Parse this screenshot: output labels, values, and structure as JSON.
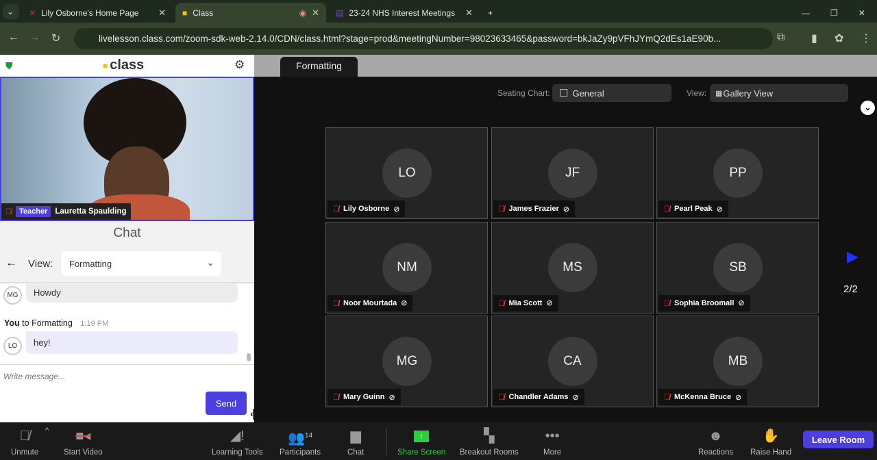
{
  "browser": {
    "tabs": [
      {
        "title": "Lily Osborne's Home Page"
      },
      {
        "title": "Class"
      },
      {
        "title": "23-24 NHS Interest Meetings"
      }
    ],
    "url": "livelesson.class.com/zoom-sdk-web-2.14.0/CDN/class.html?stage=prod&meetingNumber=98023633465&password=bkJaZy9pVFhJYmQ2dEs1aE90b..."
  },
  "app": {
    "logo": "class",
    "teacher_badge": "Teacher",
    "teacher_name": "Lauretta Spaulding"
  },
  "chat": {
    "title": "Chat",
    "view_label": "View:",
    "view_value": "Formatting",
    "messages": [
      {
        "initials": "MG",
        "text": "Howdy"
      },
      {
        "sender": "You",
        "to": "to Formatting",
        "time": "1:19 PM",
        "initials": "LO",
        "text": "hey!"
      }
    ],
    "placeholder": "Write message...",
    "send": "Send"
  },
  "room": {
    "tab": "Formatting",
    "seating_label": "Seating Chart:",
    "seating_value": "General",
    "view_label": "View:",
    "view_value": "Gallery View",
    "page": "2/2",
    "participants": [
      {
        "initials": "LO",
        "name": "Lily Osborne"
      },
      {
        "initials": "JF",
        "name": "James Frazier"
      },
      {
        "initials": "PP",
        "name": "Pearl Peak"
      },
      {
        "initials": "NM",
        "name": "Noor Mourtada"
      },
      {
        "initials": "MS",
        "name": "Mia Scott"
      },
      {
        "initials": "SB",
        "name": "Sophia Broomall"
      },
      {
        "initials": "MG",
        "name": "Mary Guinn"
      },
      {
        "initials": "CA",
        "name": "Chandler Adams"
      },
      {
        "initials": "MB",
        "name": "McKenna Bruce"
      }
    ]
  },
  "toolbar": {
    "unmute": "Unmute",
    "start_video": "Start Video",
    "learning_tools": "Learning Tools",
    "participants": "Participants",
    "participants_count": "14",
    "chat": "Chat",
    "share_screen": "Share Screen",
    "breakout_rooms": "Breakout Rooms",
    "more": "More",
    "reactions": "Reactions",
    "raise_hand": "Raise Hand",
    "leave_room": "Leave Room"
  },
  "colors": {
    "accent": "#4b3fe0",
    "share": "#2ecc40"
  }
}
